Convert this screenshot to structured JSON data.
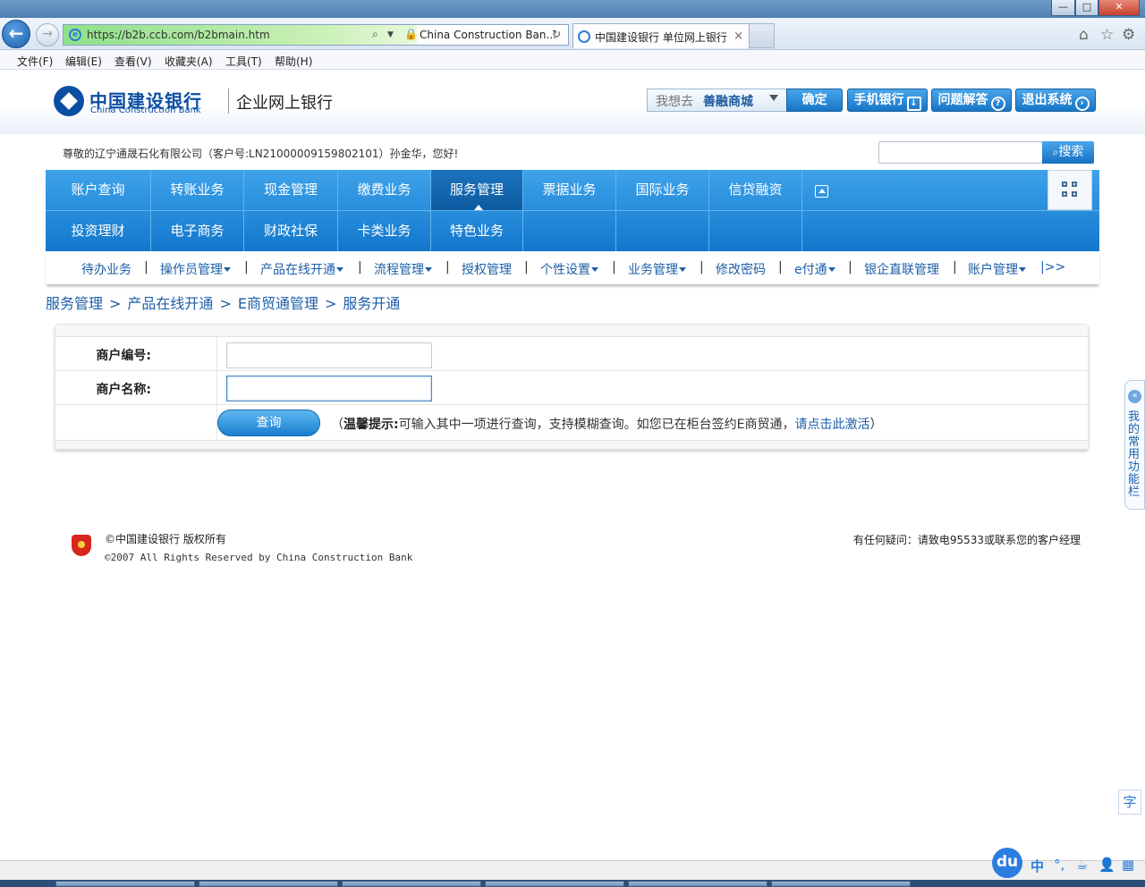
{
  "browser": {
    "url": "https://b2b.ccb.com/b2bmain.htm",
    "site_identity": "China Construction Ban...",
    "tab_title": "中国建设银行 单位网上银行",
    "tab_close": "×",
    "back_glyph": "←",
    "forward_glyph": "→",
    "menu": [
      "文件(F)",
      "编辑(E)",
      "查看(V)",
      "收藏夹(A)",
      "工具(T)",
      "帮助(H)"
    ]
  },
  "header": {
    "logo_cn": "中国建设银行",
    "logo_en": "China Construction Bank",
    "subtitle": "企业网上银行",
    "goto_prefix": "我想去",
    "goto_value": "善融商城",
    "confirm": "确定",
    "mobile_bank": "手机银行",
    "faq": "问题解答",
    "logout": "退出系统",
    "search_button": "搜索"
  },
  "welcome_text": "尊敬的辽宁通晟石化有限公司（客户号:LN21000009159802101）孙金华，您好!",
  "main_nav": {
    "row1": [
      "账户查询",
      "转账业务",
      "现金管理",
      "缴费业务",
      "服务管理",
      "票据业务",
      "国际业务",
      "信贷融资"
    ],
    "row2": [
      "投资理财",
      "电子商务",
      "财政社保",
      "卡类业务",
      "特色业务"
    ],
    "active": "服务管理"
  },
  "sub_nav": {
    "items": [
      "待办业务",
      "操作员管理",
      "产品在线开通",
      "流程管理",
      "授权管理",
      "个性设置",
      "业务管理",
      "修改密码",
      "e付通",
      "银企直联管理",
      "账户管理"
    ],
    "separator": "|",
    "more": "|>>"
  },
  "breadcrumb": [
    "服务管理",
    "产品在线开通",
    "E商贸通管理",
    "服务开通"
  ],
  "breadcrumb_sep": ">",
  "form": {
    "merchant_id_label": "商户编号:",
    "merchant_id_value": "",
    "merchant_name_label": "商户名称:",
    "merchant_name_value": "",
    "query_button": "查询",
    "tip_open": "（",
    "tip_bold": "温馨提示:",
    "tip_text": "可输入其中一项进行查询，支持模糊查询。如您已在柜台签约E商贸通，",
    "tip_link": "请点击此激活",
    "tip_close": "）"
  },
  "footer": {
    "copyright_cn": "©中国建设银行 版权所有",
    "copyright_en": "©2007 All Rights Reserved by China Construction Bank",
    "contact": "有任何疑问：请致电95533或联系您的客户经理"
  },
  "side_panel": {
    "text": "我的常用功能栏",
    "collapse_glyph": "«"
  },
  "zi_button": "字",
  "ime": {
    "logo": "du",
    "lang": "中",
    "punct": "°,",
    "icons": [
      "cup-icon",
      "user-icon",
      "grid-icon"
    ]
  }
}
